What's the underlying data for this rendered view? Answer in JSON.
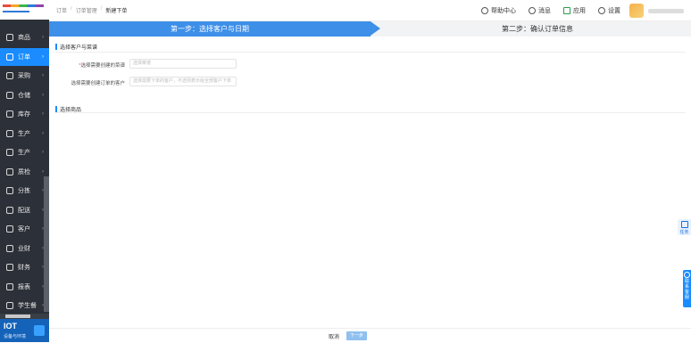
{
  "sidebar": {
    "items": [
      {
        "label": "商品",
        "icon": "grid-icon"
      },
      {
        "label": "订单",
        "icon": "order-icon",
        "active": true
      },
      {
        "label": "采购",
        "icon": "truck-icon"
      },
      {
        "label": "仓储",
        "icon": "warehouse-icon"
      },
      {
        "label": "库存",
        "icon": "inventory-icon"
      },
      {
        "label": "生产",
        "icon": "factory-icon"
      },
      {
        "label": "生产",
        "icon": "factory-icon"
      },
      {
        "label": "质检",
        "icon": "inspect-icon"
      },
      {
        "label": "分拣",
        "icon": "sort-icon"
      },
      {
        "label": "配送",
        "icon": "delivery-icon"
      },
      {
        "label": "客户",
        "icon": "user-icon"
      },
      {
        "label": "业财",
        "icon": "finance-icon"
      },
      {
        "label": "财务",
        "icon": "finance-icon"
      },
      {
        "label": "报表",
        "icon": "report-icon"
      },
      {
        "label": "学生餐",
        "icon": "meal-icon"
      }
    ],
    "footer": {
      "title": "IOT",
      "subtitle": "设备与环境"
    }
  },
  "header": {
    "breadcrumb": [
      "订单",
      "订单管理",
      "新建下单"
    ],
    "tools": [
      {
        "label": "帮助中心",
        "icon": "help-icon"
      },
      {
        "label": "消息",
        "icon": "bell-icon"
      },
      {
        "label": "应用",
        "icon": "app-icon"
      },
      {
        "label": "设置",
        "icon": "gear-icon"
      }
    ]
  },
  "steps": {
    "step1": "第一步：选择客户与日期",
    "step2": "第二步：确认订单信息"
  },
  "section1": {
    "title": "选择客户与菜谱",
    "fields": [
      {
        "label": "选择需要创建的菜谱",
        "required": true,
        "placeholder": "选择菜谱"
      },
      {
        "label": "选择需要创建订单的客户",
        "required": false,
        "placeholder": "选择需要下单的客户，不选则表示给全部客户下单"
      }
    ]
  },
  "section2": {
    "title": "选择商品"
  },
  "float": {
    "task": "任务",
    "service": "联系客服"
  },
  "footer": {
    "cancel": "取消",
    "next": "下一步"
  },
  "colors": {
    "accent": "#1a8cff",
    "sidebar_bg": "#2c3038",
    "step_active": "#3d8fe8"
  }
}
